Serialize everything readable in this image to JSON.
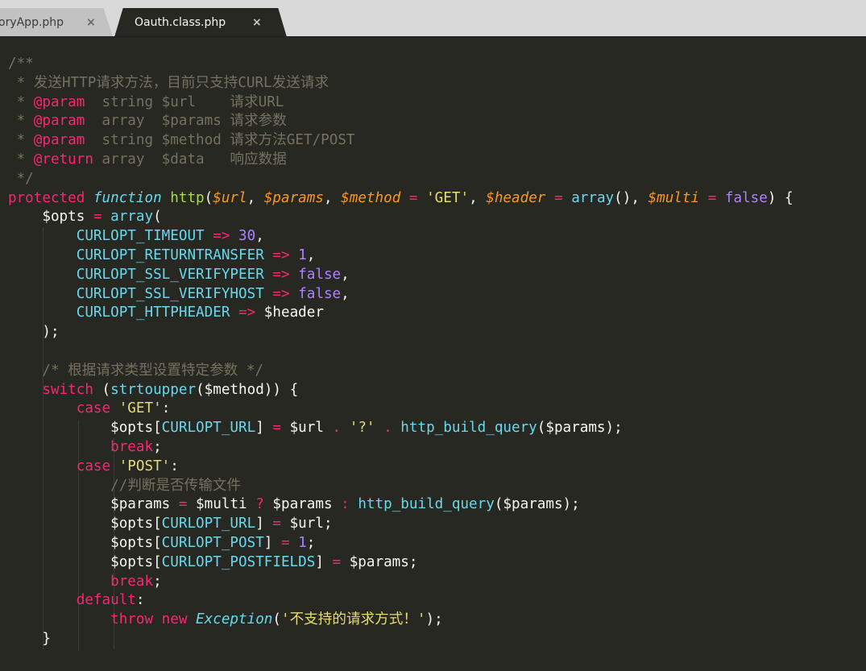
{
  "tabs": [
    {
      "label": "oryApp.php",
      "close": "×",
      "active": false
    },
    {
      "label": "Oauth.class.php",
      "close": "×",
      "active": true
    }
  ],
  "code": {
    "lines": [
      [
        {
          "t": "/**",
          "c": "c"
        }
      ],
      [
        {
          "t": " * 发送HTTP请求方法，目前只支持CURL发送请求",
          "c": "c"
        }
      ],
      [
        {
          "t": " * ",
          "c": "c"
        },
        {
          "t": "@param",
          "c": "k"
        },
        {
          "t": "  string $url    请求URL",
          "c": "c"
        }
      ],
      [
        {
          "t": " * ",
          "c": "c"
        },
        {
          "t": "@param",
          "c": "k"
        },
        {
          "t": "  array  $params 请求参数",
          "c": "c"
        }
      ],
      [
        {
          "t": " * ",
          "c": "c"
        },
        {
          "t": "@param",
          "c": "k"
        },
        {
          "t": "  string $method 请求方法GET/POST",
          "c": "c"
        }
      ],
      [
        {
          "t": " * ",
          "c": "c"
        },
        {
          "t": "@return",
          "c": "k"
        },
        {
          "t": " array  $data   响应数据",
          "c": "c"
        }
      ],
      [
        {
          "t": " */",
          "c": "c"
        }
      ],
      [
        {
          "t": "protected",
          "c": "k"
        },
        {
          "t": " ",
          "c": "t"
        },
        {
          "t": "function",
          "c": "sf"
        },
        {
          "t": " ",
          "c": "t"
        },
        {
          "t": "http",
          "c": "f"
        },
        {
          "t": "(",
          "c": "t"
        },
        {
          "t": "$url",
          "c": "p"
        },
        {
          "t": ", ",
          "c": "t"
        },
        {
          "t": "$params",
          "c": "p"
        },
        {
          "t": ", ",
          "c": "t"
        },
        {
          "t": "$method",
          "c": "p"
        },
        {
          "t": " ",
          "c": "t"
        },
        {
          "t": "=",
          "c": "k"
        },
        {
          "t": " ",
          "c": "t"
        },
        {
          "t": "'GET'",
          "c": "s"
        },
        {
          "t": ", ",
          "c": "t"
        },
        {
          "t": "$header",
          "c": "p"
        },
        {
          "t": " ",
          "c": "t"
        },
        {
          "t": "=",
          "c": "k"
        },
        {
          "t": " ",
          "c": "t"
        },
        {
          "t": "array",
          "c": "b"
        },
        {
          "t": "(), ",
          "c": "t"
        },
        {
          "t": "$multi",
          "c": "p"
        },
        {
          "t": " ",
          "c": "t"
        },
        {
          "t": "=",
          "c": "k"
        },
        {
          "t": " ",
          "c": "t"
        },
        {
          "t": "false",
          "c": "n"
        },
        {
          "t": ") {",
          "c": "t"
        }
      ],
      [
        {
          "t": "    $opts ",
          "c": "t"
        },
        {
          "t": "=",
          "c": "k"
        },
        {
          "t": " ",
          "c": "t"
        },
        {
          "t": "array",
          "c": "b"
        },
        {
          "t": "(",
          "c": "t"
        }
      ],
      [
        {
          "t": "        ",
          "c": "t"
        },
        {
          "t": "CURLOPT_TIMEOUT",
          "c": "b"
        },
        {
          "t": " ",
          "c": "t"
        },
        {
          "t": "=>",
          "c": "k"
        },
        {
          "t": " ",
          "c": "t"
        },
        {
          "t": "30",
          "c": "n"
        },
        {
          "t": ",",
          "c": "t"
        }
      ],
      [
        {
          "t": "        ",
          "c": "t"
        },
        {
          "t": "CURLOPT_RETURNTRANSFER",
          "c": "b"
        },
        {
          "t": " ",
          "c": "t"
        },
        {
          "t": "=>",
          "c": "k"
        },
        {
          "t": " ",
          "c": "t"
        },
        {
          "t": "1",
          "c": "n"
        },
        {
          "t": ",",
          "c": "t"
        }
      ],
      [
        {
          "t": "        ",
          "c": "t"
        },
        {
          "t": "CURLOPT_SSL_VERIFYPEER",
          "c": "b"
        },
        {
          "t": " ",
          "c": "t"
        },
        {
          "t": "=>",
          "c": "k"
        },
        {
          "t": " ",
          "c": "t"
        },
        {
          "t": "false",
          "c": "n"
        },
        {
          "t": ",",
          "c": "t"
        }
      ],
      [
        {
          "t": "        ",
          "c": "t"
        },
        {
          "t": "CURLOPT_SSL_VERIFYHOST",
          "c": "b"
        },
        {
          "t": " ",
          "c": "t"
        },
        {
          "t": "=>",
          "c": "k"
        },
        {
          "t": " ",
          "c": "t"
        },
        {
          "t": "false",
          "c": "n"
        },
        {
          "t": ",",
          "c": "t"
        }
      ],
      [
        {
          "t": "        ",
          "c": "t"
        },
        {
          "t": "CURLOPT_HTTPHEADER",
          "c": "b"
        },
        {
          "t": " ",
          "c": "t"
        },
        {
          "t": "=>",
          "c": "k"
        },
        {
          "t": " $header",
          "c": "t"
        }
      ],
      [
        {
          "t": "    );",
          "c": "t"
        }
      ],
      [
        {
          "t": "",
          "c": "t"
        }
      ],
      [
        {
          "t": "    ",
          "c": "t"
        },
        {
          "t": "/* 根据请求类型设置特定参数 */",
          "c": "c"
        }
      ],
      [
        {
          "t": "    ",
          "c": "t"
        },
        {
          "t": "switch",
          "c": "k"
        },
        {
          "t": " (",
          "c": "t"
        },
        {
          "t": "strtoupper",
          "c": "b"
        },
        {
          "t": "($method)) {",
          "c": "t"
        }
      ],
      [
        {
          "t": "        ",
          "c": "t"
        },
        {
          "t": "case",
          "c": "k"
        },
        {
          "t": " ",
          "c": "t"
        },
        {
          "t": "'GET'",
          "c": "s"
        },
        {
          "t": ":",
          "c": "t"
        }
      ],
      [
        {
          "t": "            $opts[",
          "c": "t"
        },
        {
          "t": "CURLOPT_URL",
          "c": "b"
        },
        {
          "t": "] ",
          "c": "t"
        },
        {
          "t": "=",
          "c": "k"
        },
        {
          "t": " $url ",
          "c": "t"
        },
        {
          "t": ".",
          "c": "k"
        },
        {
          "t": " ",
          "c": "t"
        },
        {
          "t": "'?'",
          "c": "s"
        },
        {
          "t": " ",
          "c": "t"
        },
        {
          "t": ".",
          "c": "k"
        },
        {
          "t": " ",
          "c": "t"
        },
        {
          "t": "http_build_query",
          "c": "b"
        },
        {
          "t": "($params);",
          "c": "t"
        }
      ],
      [
        {
          "t": "            ",
          "c": "t"
        },
        {
          "t": "break",
          "c": "k"
        },
        {
          "t": ";",
          "c": "t"
        }
      ],
      [
        {
          "t": "        ",
          "c": "t"
        },
        {
          "t": "case",
          "c": "k"
        },
        {
          "t": " ",
          "c": "t"
        },
        {
          "t": "'POST'",
          "c": "s"
        },
        {
          "t": ":",
          "c": "t"
        }
      ],
      [
        {
          "t": "            ",
          "c": "t"
        },
        {
          "t": "//判断是否传输文件",
          "c": "c"
        }
      ],
      [
        {
          "t": "            $params ",
          "c": "t"
        },
        {
          "t": "=",
          "c": "k"
        },
        {
          "t": " $multi ",
          "c": "t"
        },
        {
          "t": "?",
          "c": "k"
        },
        {
          "t": " $params ",
          "c": "t"
        },
        {
          "t": ":",
          "c": "k"
        },
        {
          "t": " ",
          "c": "t"
        },
        {
          "t": "http_build_query",
          "c": "b"
        },
        {
          "t": "($params);",
          "c": "t"
        }
      ],
      [
        {
          "t": "            $opts[",
          "c": "t"
        },
        {
          "t": "CURLOPT_URL",
          "c": "b"
        },
        {
          "t": "] ",
          "c": "t"
        },
        {
          "t": "=",
          "c": "k"
        },
        {
          "t": " $url;",
          "c": "t"
        }
      ],
      [
        {
          "t": "            $opts[",
          "c": "t"
        },
        {
          "t": "CURLOPT_POST",
          "c": "b"
        },
        {
          "t": "] ",
          "c": "t"
        },
        {
          "t": "=",
          "c": "k"
        },
        {
          "t": " ",
          "c": "t"
        },
        {
          "t": "1",
          "c": "n"
        },
        {
          "t": ";",
          "c": "t"
        }
      ],
      [
        {
          "t": "            $opts[",
          "c": "t"
        },
        {
          "t": "CURLOPT_POSTFIELDS",
          "c": "b"
        },
        {
          "t": "] ",
          "c": "t"
        },
        {
          "t": "=",
          "c": "k"
        },
        {
          "t": " $params;",
          "c": "t"
        }
      ],
      [
        {
          "t": "            ",
          "c": "t"
        },
        {
          "t": "break",
          "c": "k"
        },
        {
          "t": ";",
          "c": "t"
        }
      ],
      [
        {
          "t": "        ",
          "c": "t"
        },
        {
          "t": "default",
          "c": "k"
        },
        {
          "t": ":",
          "c": "t"
        }
      ],
      [
        {
          "t": "            ",
          "c": "t"
        },
        {
          "t": "throw",
          "c": "k"
        },
        {
          "t": " ",
          "c": "t"
        },
        {
          "t": "new",
          "c": "k"
        },
        {
          "t": " ",
          "c": "t"
        },
        {
          "t": "Exception",
          "c": "sf"
        },
        {
          "t": "(",
          "c": "t"
        },
        {
          "t": "'不支持的请求方式！'",
          "c": "s"
        },
        {
          "t": ");",
          "c": "t"
        }
      ],
      [
        {
          "t": "    }",
          "c": "t"
        }
      ]
    ]
  },
  "theme": {
    "background": "#272822",
    "comment": "#75715e",
    "keyword": "#f92672",
    "string": "#e6db74",
    "number": "#ae81ff",
    "function": "#a6e22e",
    "builtin": "#66d9ef",
    "parameter": "#fd971f"
  }
}
